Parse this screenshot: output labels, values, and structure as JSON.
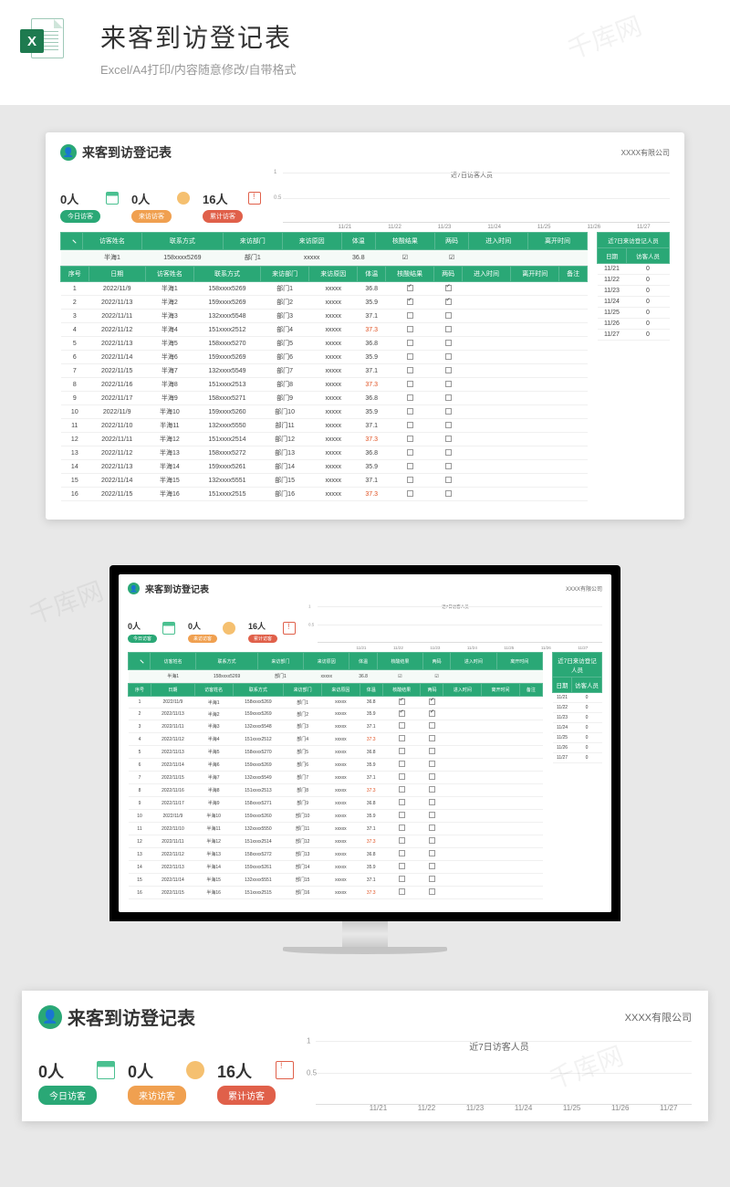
{
  "hero": {
    "title": "来客到访登记表",
    "subtitle": "Excel/A4打印/内容随意修改/自带格式",
    "excel_letter": "X"
  },
  "template": {
    "title": "来客到访登记表",
    "company": "XXXX有限公司",
    "stats": [
      {
        "value": "0人",
        "label": "今日访客",
        "cls": "g"
      },
      {
        "value": "0人",
        "label": "来访访客",
        "cls": "o"
      },
      {
        "value": "16人",
        "label": "累计访客",
        "cls": "r"
      }
    ],
    "chart_title": "近7日访客人员",
    "filter_headers": [
      "访客姓名",
      "联系方式",
      "来访部门",
      "来访原因",
      "体温",
      "核酸结果",
      "两码",
      "进入时间",
      "离开时间"
    ],
    "filter_sample": [
      "半海1",
      "158xxxx5269",
      "部门1",
      "xxxxx",
      "36.8",
      "☑",
      "☑",
      "",
      ""
    ],
    "headers": [
      "序号",
      "日期",
      "访客姓名",
      "联系方式",
      "来访部门",
      "来访原因",
      "体温",
      "核酸结果",
      "两码",
      "进入时间",
      "离开时间",
      "备注"
    ],
    "rows": [
      [
        "1",
        "2022/11/9",
        "半海1",
        "158xxxx5269",
        "部门1",
        "xxxxx",
        "36.8",
        "on",
        "on",
        "",
        "",
        ""
      ],
      [
        "2",
        "2022/11/13",
        "半海2",
        "159xxxx5269",
        "部门2",
        "xxxxx",
        "35.9",
        "on",
        "on",
        "",
        "",
        ""
      ],
      [
        "3",
        "2022/11/11",
        "半海3",
        "132xxxx5548",
        "部门3",
        "xxxxx",
        "37.1",
        "",
        "",
        "",
        "",
        ""
      ],
      [
        "4",
        "2022/11/12",
        "半海4",
        "151xxxx2512",
        "部门4",
        "xxxxx",
        "37.3",
        "",
        "",
        "",
        "",
        ""
      ],
      [
        "5",
        "2022/11/13",
        "半海5",
        "158xxxx5270",
        "部门5",
        "xxxxx",
        "36.8",
        "",
        "",
        "",
        "",
        ""
      ],
      [
        "6",
        "2022/11/14",
        "半海6",
        "159xxxx5269",
        "部门6",
        "xxxxx",
        "35.9",
        "",
        "",
        "",
        "",
        ""
      ],
      [
        "7",
        "2022/11/15",
        "半海7",
        "132xxxx5549",
        "部门7",
        "xxxxx",
        "37.1",
        "",
        "",
        "",
        "",
        ""
      ],
      [
        "8",
        "2022/11/16",
        "半海8",
        "151xxxx2513",
        "部门8",
        "xxxxx",
        "37.3",
        "",
        "",
        "",
        "",
        ""
      ],
      [
        "9",
        "2022/11/17",
        "半海9",
        "158xxxx5271",
        "部门9",
        "xxxxx",
        "36.8",
        "",
        "",
        "",
        "",
        ""
      ],
      [
        "10",
        "2022/11/9",
        "半海10",
        "159xxxx5260",
        "部门10",
        "xxxxx",
        "35.9",
        "",
        "",
        "",
        "",
        ""
      ],
      [
        "11",
        "2022/11/10",
        "半海11",
        "132xxxx5550",
        "部门11",
        "xxxxx",
        "37.1",
        "",
        "",
        "",
        "",
        ""
      ],
      [
        "12",
        "2022/11/11",
        "半海12",
        "151xxxx2514",
        "部门12",
        "xxxxx",
        "37.3",
        "",
        "",
        "",
        "",
        ""
      ],
      [
        "13",
        "2022/11/12",
        "半海13",
        "158xxxx5272",
        "部门13",
        "xxxxx",
        "36.8",
        "",
        "",
        "",
        "",
        ""
      ],
      [
        "14",
        "2022/11/13",
        "半海14",
        "159xxxx5261",
        "部门14",
        "xxxxx",
        "35.9",
        "",
        "",
        "",
        "",
        ""
      ],
      [
        "15",
        "2022/11/14",
        "半海15",
        "132xxxx5551",
        "部门15",
        "xxxxx",
        "37.1",
        "",
        "",
        "",
        "",
        ""
      ],
      [
        "16",
        "2022/11/15",
        "半海16",
        "151xxxx2515",
        "部门16",
        "xxxxx",
        "37.3",
        "",
        "",
        "",
        "",
        ""
      ]
    ],
    "side_title": "近7日来访登记人员",
    "side_headers": [
      "日期",
      "访客人员"
    ],
    "side_rows": [
      [
        "11/21",
        "0"
      ],
      [
        "11/22",
        "0"
      ],
      [
        "11/23",
        "0"
      ],
      [
        "11/24",
        "0"
      ],
      [
        "11/25",
        "0"
      ],
      [
        "11/26",
        "0"
      ],
      [
        "11/27",
        "0"
      ]
    ]
  },
  "chart_data": {
    "type": "bar",
    "title": "近7日访客人员",
    "categories": [
      "11/21",
      "11/22",
      "11/23",
      "11/24",
      "11/25",
      "11/26",
      "11/27"
    ],
    "values": [
      0,
      0,
      0,
      0,
      0,
      0,
      0
    ],
    "ylabel": "",
    "xlabel": "",
    "yticks": [
      0.5,
      1
    ],
    "ylim": [
      0,
      1
    ]
  },
  "watermark": "千库网"
}
